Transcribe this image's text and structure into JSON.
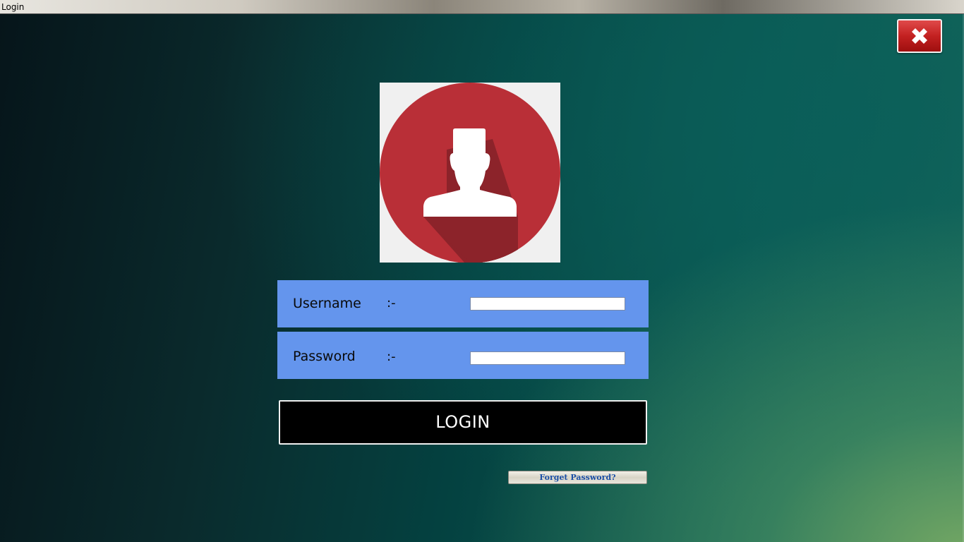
{
  "window": {
    "title": "Login"
  },
  "close_button": {
    "icon": "close-icon"
  },
  "avatar": {
    "icon": "user-silhouette-icon",
    "circle_color": "#b92f37",
    "shadow_color": "#8c232a",
    "box_color": "#f0f0f0"
  },
  "form": {
    "username": {
      "label": "Username",
      "separator": ":-",
      "value": ""
    },
    "password": {
      "label": "Password",
      "separator": ":-",
      "value": ""
    },
    "row_color": "#6495ed"
  },
  "login_button": {
    "label": "LOGIN"
  },
  "forgot_password": {
    "label": "Forget Password?"
  }
}
